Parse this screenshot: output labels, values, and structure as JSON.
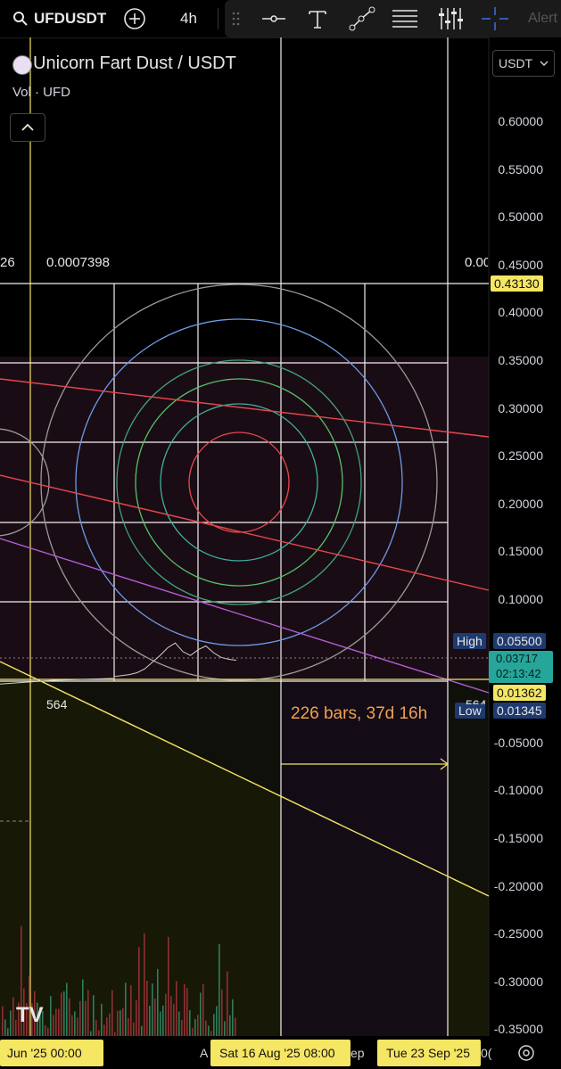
{
  "toolbar": {
    "symbol": "UFDUSDT",
    "interval": "4h",
    "alert_label": "Alert"
  },
  "legend": {
    "title": "Unicorn Fart Dust / USDT",
    "volume_label": "Vol · UFD",
    "quote_currency": "USDT"
  },
  "price_axis": {
    "ticks": [
      "0.60000",
      "0.55000",
      "0.50000",
      "0.45000",
      "0.40000",
      "0.35000",
      "0.30000",
      "0.25000",
      "0.20000",
      "0.15000",
      "0.10000",
      "-0.05000",
      "-0.10000",
      "-0.15000",
      "-0.20000",
      "-0.25000",
      "-0.30000",
      "-0.35000"
    ],
    "price_tag": "0.43130",
    "high_label": "High",
    "high_value": "0.05500",
    "last_price": "0.03717",
    "countdown": "02:13:42",
    "level_value": "0.01362",
    "low_label": "Low",
    "low_value": "0.01345"
  },
  "annotations": {
    "fib_left_cut": "26",
    "fib_value_left": "0.0007398",
    "fib_value_right": "0.00",
    "point_label": "564",
    "point_label_right": "564",
    "range_text": "226 bars, 37d 16h"
  },
  "time_axis": {
    "left_label": "Jun '25  00:00",
    "a_label": "A",
    "sat_label": "Sat 16 Aug '25  08:00",
    "ep_label": "ep",
    "tue_label": "Tue 23 Sep '25",
    "right_cut": "0("
  },
  "logo_text": "TV",
  "colors": {
    "accent_yellow": "#f5e663",
    "grid_white": "#f0f0f0",
    "red_line": "#e8474e",
    "purple_line": "#b15cd6",
    "range_orange": "#f0a050",
    "high_low_bg": "#1e3a6e",
    "last_price_bg": "#26a69a"
  },
  "chart_data": {
    "type": "line",
    "title": "Unicorn Fart Dust / USDT",
    "xlabel": "",
    "ylabel": "",
    "ylim": [
      -0.35,
      0.6
    ],
    "series": [
      {
        "name": "UFDUSDT",
        "values": [
          0.02,
          0.021,
          0.022,
          0.024,
          0.028,
          0.035,
          0.042,
          0.05,
          0.055,
          0.046,
          0.042,
          0.048,
          0.052,
          0.045,
          0.04,
          0.038,
          0.037
        ]
      }
    ]
  }
}
